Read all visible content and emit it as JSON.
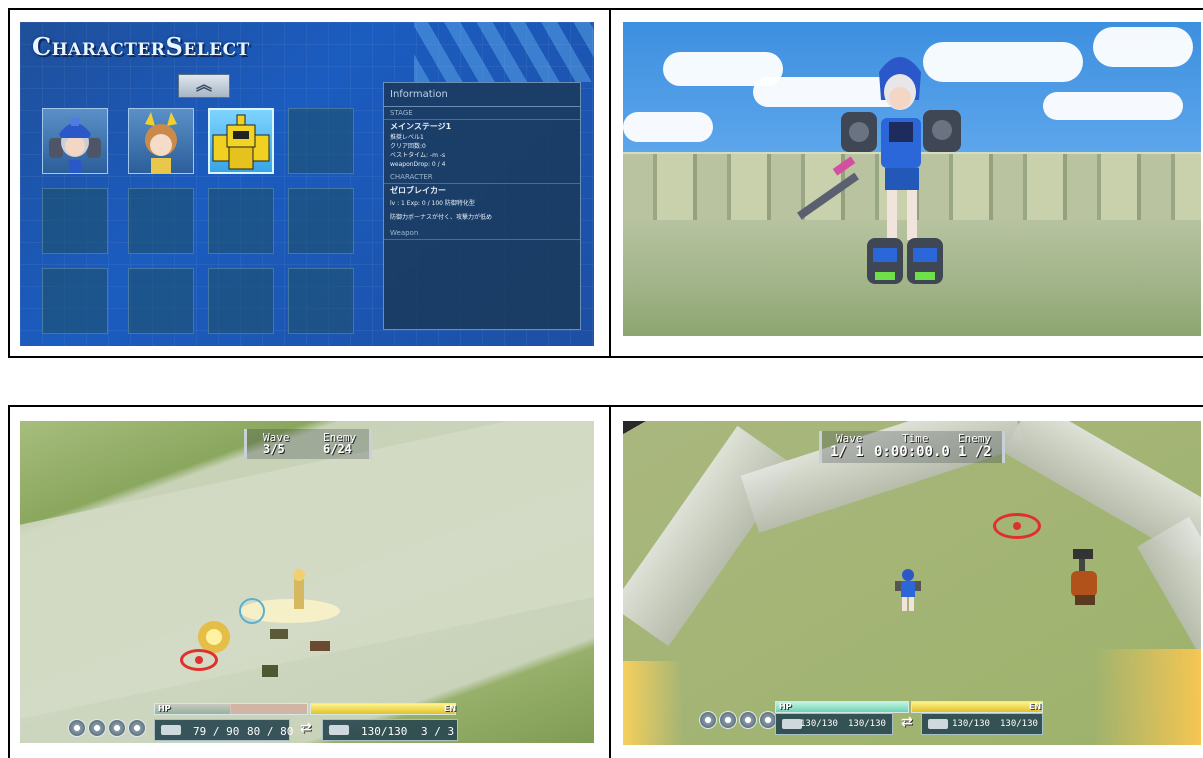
{
  "panel_character_select": {
    "title": "CharacterSelect",
    "up_arrow": "︽",
    "info": {
      "header": "Information",
      "stage_label": "STAGE",
      "stage_name": "メインステージ1",
      "stage_lines": [
        "推奨レベル1",
        "クリア回数:0",
        "ベストタイム: -m -s",
        "weaponDrop: 0 / 4"
      ],
      "character_label": "CHARACTER",
      "character_name": "ゼロブレイカー",
      "character_stats": "lv : 1  Exp: 0 / 100  防御特化型",
      "character_desc": "防御力ボーナスが付く、攻撃力が低め",
      "weapon_label": "Weapon"
    }
  },
  "panel_field": {
    "wave_label": "Wave",
    "wave_value": "3/5",
    "enemy_label": "Enemy",
    "enemy_value": "6/24",
    "hp_label": "HP",
    "en_label": "EN",
    "hp_fill": 0.5,
    "en_fill": 1.0,
    "main_weapon_value": "79 / 90",
    "sub_weapon_value": "80 / 80",
    "weapon2_main_value": "130/130",
    "weapon2_sub_value": "3 / 3",
    "swap_symbol": "⇄"
  },
  "panel_canyon": {
    "wave_label": "Wave",
    "wave_value": "1/ 1",
    "time_label": "Time",
    "time_value": "0:00:00.0",
    "enemy_label": "Enemy",
    "enemy_value": "1 /2",
    "hp_label": "HP",
    "en_label": "EN",
    "hp_fill": 1.0,
    "en_fill": 1.0,
    "weapon1_main_value": "130/130",
    "weapon1_sub_value": "130/130",
    "weapon2_main_value": "130/130",
    "weapon2_sub_value": "130/130",
    "swap_symbol": "⇄"
  }
}
